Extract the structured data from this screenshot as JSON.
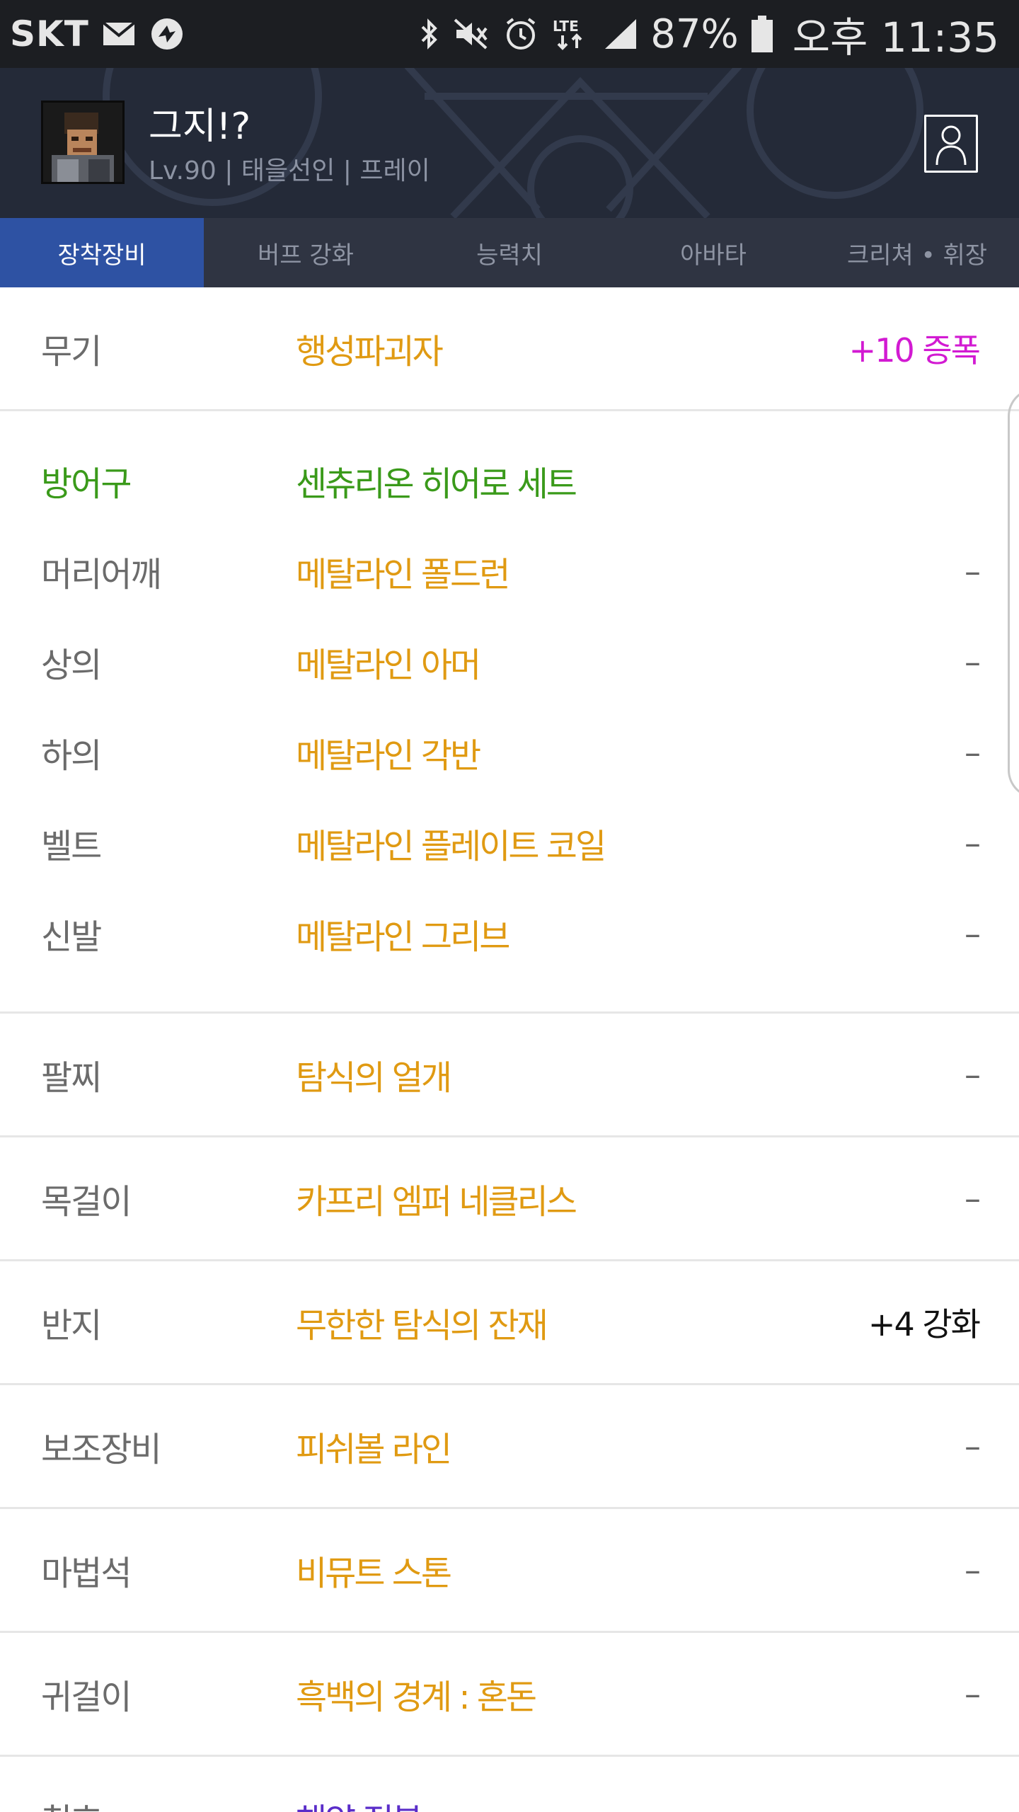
{
  "status_bar": {
    "carrier": "SKT",
    "battery": "87%",
    "time": "오후 11:35",
    "icons": [
      "mail-icon",
      "app-icon",
      "bluetooth-icon",
      "mute-icon",
      "alarm-icon",
      "lte-icon",
      "signal-icon",
      "battery-icon"
    ]
  },
  "profile": {
    "name": "그지!?",
    "info": "Lv.90 | 태을선인 | 프레이"
  },
  "tabs": [
    "장착장비",
    "버프 강화",
    "능력치",
    "아바타",
    "크리쳐 • 휘장"
  ],
  "equipment": {
    "weapon": {
      "slot": "무기",
      "item": "행성파괴자",
      "extra": "+10 증폭"
    },
    "armor_header": {
      "slot": "방어구",
      "item": "센츄리온 히어로 세트"
    },
    "armor": [
      {
        "slot": "머리어깨",
        "item": "메탈라인 폴드런",
        "extra": "–"
      },
      {
        "slot": "상의",
        "item": "메탈라인 아머",
        "extra": "–"
      },
      {
        "slot": "하의",
        "item": "메탈라인 각반",
        "extra": "–"
      },
      {
        "slot": "벨트",
        "item": "메탈라인 플레이트 코일",
        "extra": "–"
      },
      {
        "slot": "신발",
        "item": "메탈라인 그리브",
        "extra": "–"
      }
    ],
    "others": [
      {
        "slot": "팔찌",
        "item": "탐식의 얼개",
        "extra": "–"
      },
      {
        "slot": "목걸이",
        "item": "카프리 엠퍼 네클리스",
        "extra": "–"
      },
      {
        "slot": "반지",
        "item": "무한한 탐식의 잔재",
        "extra": "+4 강화"
      },
      {
        "slot": "보조장비",
        "item": "피쉬볼 라인",
        "extra": "–"
      },
      {
        "slot": "마법석",
        "item": "비뮤트 스톤",
        "extra": "–"
      },
      {
        "slot": "귀걸이",
        "item": "흑백의 경계 : 혼돈",
        "extra": "–"
      },
      {
        "slot": "칭호",
        "item": "해양 정복",
        "extra": "–"
      }
    ]
  },
  "colors": {
    "status_bar_bg": "#1c1e22",
    "header_bg": "#242a38",
    "tab_bg": "#2f3442",
    "tab_active_bg": "#2e52a3",
    "item_gold": "#e09a12",
    "set_green": "#3a9a1a",
    "title_purple": "#5a2dc9",
    "amplify_magenta": "#d21ad2"
  }
}
